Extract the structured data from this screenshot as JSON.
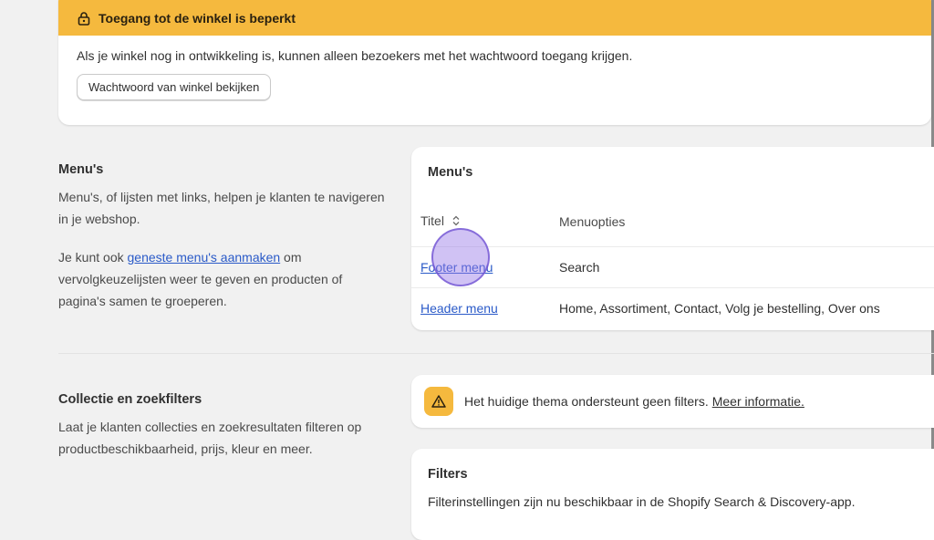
{
  "banner": {
    "title": "Toegang tot de winkel is beperkt",
    "text": "Als je winkel nog in ontwikkeling is, kunnen alleen bezoekers met het wachtwoord toegang krijgen.",
    "button_label": "Wachtwoord van winkel bekijken",
    "color": "#f5b93e"
  },
  "menus_section": {
    "title": "Menu's",
    "description": "Menu's, of lijsten met links, helpen je klanten te navigeren in je webshop.",
    "nested_prefix": "Je kunt ook ",
    "nested_link": "geneste menu's aanmaken",
    "nested_suffix": " om vervolgkeuzelijsten weer te geven en producten of pagina's samen te groeperen."
  },
  "menus_card": {
    "title": "Menu's",
    "col_title": "Titel",
    "col_options": "Menuopties",
    "rows": [
      {
        "title": "Footer menu",
        "options": "Search"
      },
      {
        "title": "Header menu",
        "options": "Home, Assortiment, Contact, Volg je bestelling, Over ons"
      }
    ]
  },
  "filters_section": {
    "title": "Collectie en zoekfilters",
    "description": "Laat je klanten collecties en zoekresultaten filteren op productbeschikbaarheid, prijs, kleur en meer."
  },
  "filters_notice": {
    "text": "Het huidige thema ondersteunt geen filters.",
    "link": "Meer informatie."
  },
  "filters_card": {
    "title": "Filters",
    "text": "Filterinstellingen zijn nu beschikbaar in de Shopify Search & Discovery-app."
  }
}
